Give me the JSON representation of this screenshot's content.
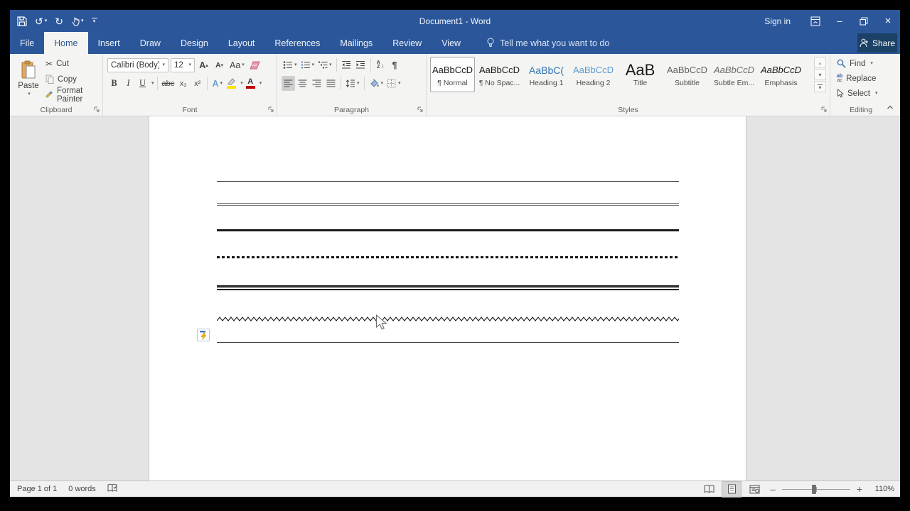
{
  "window": {
    "title": "Document1 - Word",
    "sign_in": "Sign in",
    "share_label": "Share"
  },
  "tabs": {
    "items": [
      "File",
      "Home",
      "Insert",
      "Draw",
      "Design",
      "Layout",
      "References",
      "Mailings",
      "Review",
      "View"
    ],
    "active_tab": "Home",
    "tell_me": "Tell me what you want to do"
  },
  "ribbon": {
    "clipboard": {
      "label": "Clipboard",
      "paste": "Paste",
      "cut": "Cut",
      "copy": "Copy",
      "format_painter": "Format Painter"
    },
    "font": {
      "label": "Font",
      "name_value": "Calibri (Body)",
      "size_value": "12",
      "grow": "A",
      "shrink": "A",
      "change_case": "Aa",
      "bold": "B",
      "italic": "I",
      "underline": "U",
      "strikethrough": "abc",
      "subscript": "x₂",
      "superscript": "x²",
      "text_effects": "A",
      "font_color_letter": "A"
    },
    "paragraph": {
      "label": "Paragraph"
    },
    "styles": {
      "label": "Styles",
      "items": [
        {
          "sample": "AaBbCcD",
          "name": "¶ Normal"
        },
        {
          "sample": "AaBbCcD",
          "name": "¶ No Spac..."
        },
        {
          "sample": "AaBbC(",
          "name": "Heading 1"
        },
        {
          "sample": "AaBbCcD",
          "name": "Heading 2"
        },
        {
          "sample": "AaB",
          "name": "Title"
        },
        {
          "sample": "AaBbCcD",
          "name": "Subtitle"
        },
        {
          "sample": "AaBbCcD",
          "name": "Subtle Em..."
        },
        {
          "sample": "AaBbCcD",
          "name": "Emphasis"
        }
      ]
    },
    "editing": {
      "label": "Editing",
      "find": "Find",
      "replace": "Replace",
      "select": "Select"
    }
  },
  "document": {
    "lines": [
      {
        "style": "thin-single"
      },
      {
        "style": "double-thin"
      },
      {
        "style": "thick-single"
      },
      {
        "style": "dotted"
      },
      {
        "style": "thick-triple"
      },
      {
        "style": "wavy"
      },
      {
        "style": "thin-single"
      }
    ]
  },
  "status": {
    "page": "Page 1 of 1",
    "words": "0 words",
    "zoom_level": "110%"
  },
  "icons": {
    "undo": "↺",
    "redo": "↻",
    "dropdown": "▾",
    "up_arrow": "▴",
    "scissors": "✂",
    "pilcrow": "¶",
    "minimize": "–",
    "close": "×",
    "sort_a": "A",
    "sort_z": "Z",
    "sort_arrow": "↓",
    "replace_ab": "ab",
    "replace_ac": "ac"
  },
  "colors": {
    "titlebar": "#2b579a",
    "share_button": "#1c4166",
    "heading1": "#2e74b5",
    "heading2": "#5b9bd5",
    "highlight_bar": "#ffe400",
    "font_color_bar": "#c00000"
  }
}
